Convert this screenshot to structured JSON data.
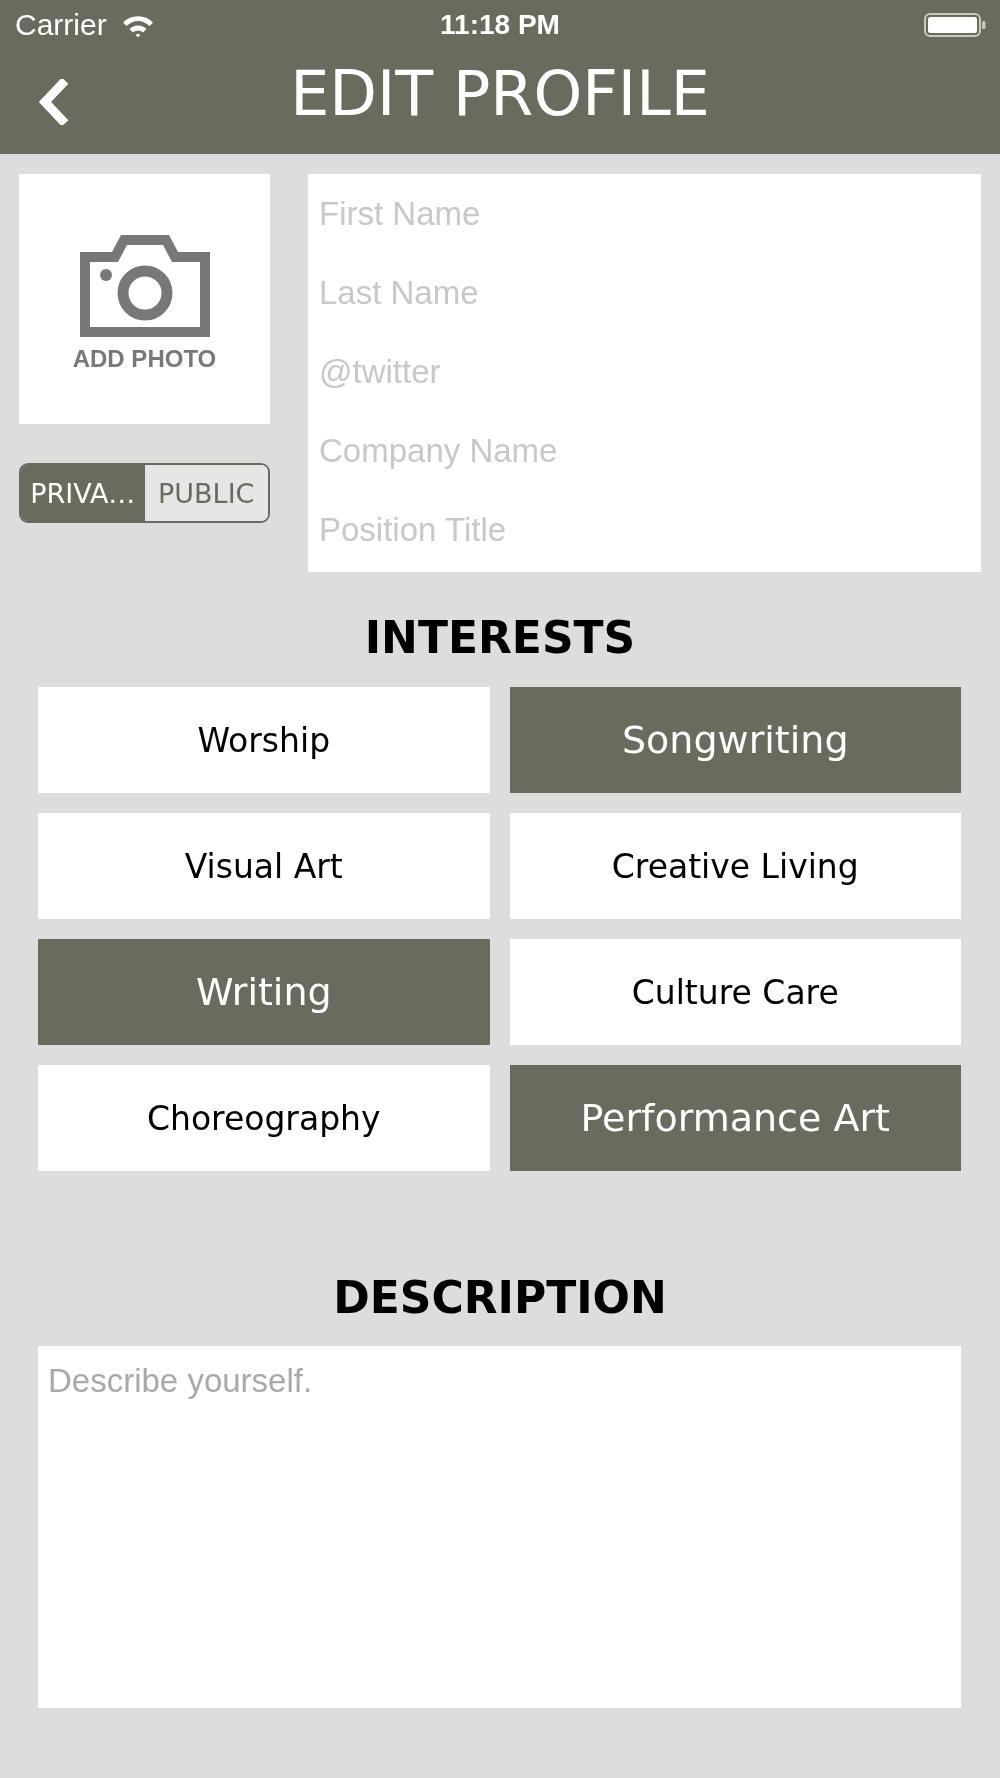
{
  "status_bar": {
    "carrier": "Carrier",
    "time": "11:18 PM"
  },
  "nav_bar": {
    "title": "EDIT PROFILE"
  },
  "photo": {
    "label": "ADD PHOTO"
  },
  "visibility_toggle": [
    {
      "label": "PRIVA…",
      "selected": true
    },
    {
      "label": "PUBLIC",
      "selected": false
    }
  ],
  "profile_fields": [
    {
      "placeholder": "First Name"
    },
    {
      "placeholder": "Last Name"
    },
    {
      "placeholder": "@twitter"
    },
    {
      "placeholder": "Company Name"
    },
    {
      "placeholder": "Position Title"
    }
  ],
  "interests": {
    "title": "INTERESTS",
    "items": [
      {
        "label": "Worship",
        "selected": false
      },
      {
        "label": "Songwriting",
        "selected": true
      },
      {
        "label": "Visual Art",
        "selected": false
      },
      {
        "label": "Creative Living",
        "selected": false
      },
      {
        "label": "Writing",
        "selected": true
      },
      {
        "label": "Culture Care",
        "selected": false
      },
      {
        "label": "Choreography",
        "selected": false
      },
      {
        "label": "Performance Art",
        "selected": true
      }
    ]
  },
  "description": {
    "title": "DESCRIPTION",
    "placeholder": "Describe yourself."
  }
}
